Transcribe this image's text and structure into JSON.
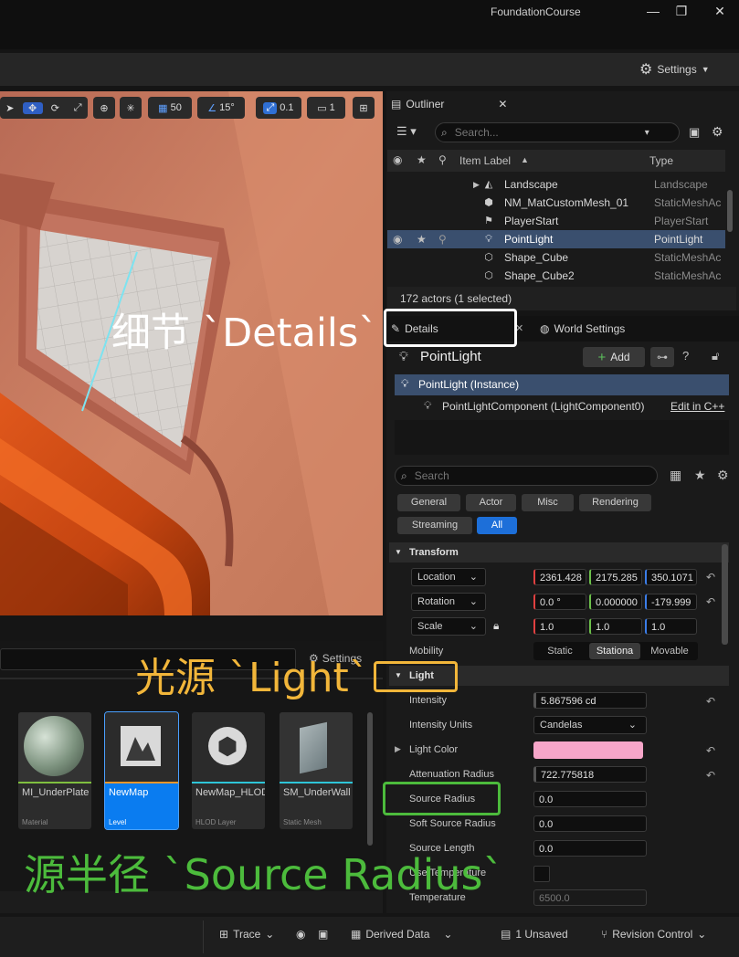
{
  "window": {
    "title": "FoundationCourse",
    "minimize": "—",
    "restore": "❐",
    "close": "✕"
  },
  "toolbar": {
    "settings_label": "Settings"
  },
  "viewport": {
    "grid_snap": "50",
    "rotation_snap": "15°",
    "scale_snap": "0.1",
    "camera_speed": "1"
  },
  "outliner": {
    "tab_label": "Outliner",
    "search_placeholder": "Search...",
    "col_label": "Item Label",
    "col_type": "Type",
    "rows": [
      {
        "label": "Landscape",
        "type": "Landscape",
        "icon": "landscape-icon"
      },
      {
        "label": "NM_MatCustomMesh_01",
        "type": "StaticMeshAc",
        "icon": "mesh-icon"
      },
      {
        "label": "PlayerStart",
        "type": "PlayerStart",
        "icon": "flag-icon"
      },
      {
        "label": "PointLight",
        "type": "PointLight",
        "icon": "light-icon",
        "selected": true
      },
      {
        "label": "Shape_Cube",
        "type": "StaticMeshAc",
        "icon": "cube-icon"
      },
      {
        "label": "Shape_Cube2",
        "type": "StaticMeshAc",
        "icon": "cube-icon"
      }
    ],
    "status": "172 actors (1 selected)"
  },
  "details": {
    "tab_label": "Details",
    "world_settings_tab": "World Settings",
    "actor_name": "PointLight",
    "add_label": "Add",
    "instance_label": "PointLight (Instance)",
    "component_label": "PointLightComponent (LightComponent0)",
    "edit_cpp": "Edit in C++",
    "search_placeholder": "Search",
    "categories": [
      "General",
      "Actor",
      "Misc",
      "Rendering",
      "Streaming",
      "All"
    ],
    "transform": {
      "title": "Transform",
      "location_label": "Location",
      "location": [
        "2361.428",
        "2175.285",
        "350.1071"
      ],
      "rotation_label": "Rotation",
      "rotation": [
        "0.0 °",
        "0.000000",
        "-179.999"
      ],
      "scale_label": "Scale",
      "scale": [
        "1.0",
        "1.0",
        "1.0"
      ],
      "mobility_label": "Mobility",
      "mobility_options": [
        "Static",
        "Stationa",
        "Movable"
      ]
    },
    "light": {
      "title": "Light",
      "intensity_label": "Intensity",
      "intensity": "5.867596 cd",
      "intensity_units_label": "Intensity Units",
      "intensity_units": "Candelas",
      "light_color_label": "Light Color",
      "light_color": "#f7a6c9",
      "attenuation_label": "Attenuation Radius",
      "attenuation": "722.775818",
      "source_radius_label": "Source Radius",
      "source_radius": "0.0",
      "soft_source_radius_label": "Soft Source Radius",
      "soft_source_radius": "0.0",
      "source_length_label": "Source Length",
      "source_length": "0.0",
      "use_temperature_label": "Use Temperature",
      "temperature_label": "Temperature",
      "temperature": "6500.0"
    }
  },
  "content_browser": {
    "settings_label": "Settings",
    "assets": [
      {
        "name": "MI_UnderPlate",
        "kind": "Material",
        "bar": "#7fbf3f",
        "selected": false
      },
      {
        "name": "NewMap",
        "kind": "Level",
        "bar": "#e8962c",
        "selected": true
      },
      {
        "name": "NewMap_HLOD0_...",
        "kind": "HLOD Layer",
        "bar": "#2ec5d8",
        "selected": false
      },
      {
        "name": "SM_UnderWall",
        "kind": "Static Mesh",
        "bar": "#2ec5d8",
        "selected": false
      }
    ]
  },
  "statusbar": {
    "trace": "Trace",
    "derived_data": "Derived Data",
    "unsaved": "1 Unsaved",
    "revision_control": "Revision Control"
  },
  "annotations": {
    "details": "细节 `Details`",
    "light": "光源 `Light`",
    "source_radius": "源半径 `Source Radius`",
    "white": "#ffffff",
    "orange": "#f2b63a",
    "green": "#4cbb3c"
  }
}
